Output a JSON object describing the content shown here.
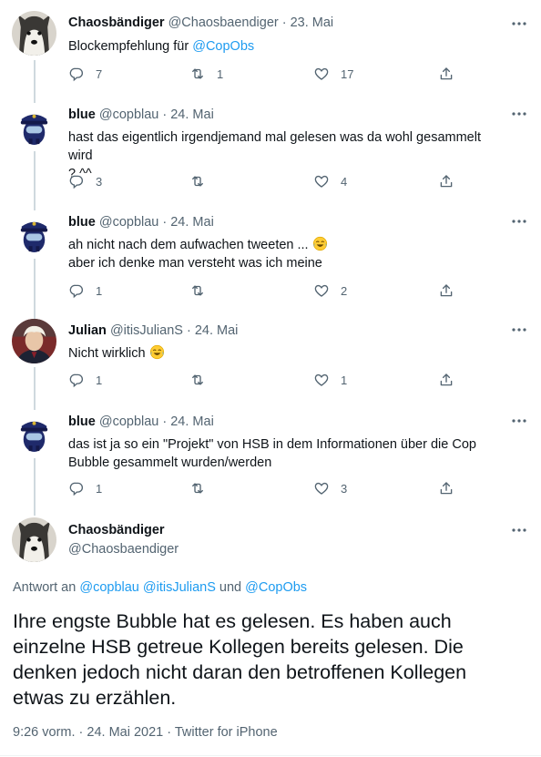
{
  "tweets": [
    {
      "name": "Chaosbändiger",
      "handle": "@Chaosbaendiger",
      "date": "· 23. Mai",
      "text_prefix": "Blockempfehlung für ",
      "text_link": "@CopObs",
      "replies": "7",
      "retweets": "1",
      "likes": "17"
    },
    {
      "name": "blue",
      "handle": "@copblau",
      "date": "· 24. Mai",
      "lines": [
        "hast das eigentlich irgendjemand mal gelesen was da wohl gesammelt wird",
        "? ^^"
      ],
      "replies": "3",
      "retweets": "",
      "likes": "4"
    },
    {
      "name": "blue",
      "handle": "@copblau",
      "date": "· 24. Mai",
      "lines": [
        "ah nicht nach dem aufwachen tweeten ... ",
        "aber ich denke man versteht was ich meine"
      ],
      "replies": "1",
      "retweets": "",
      "likes": "2"
    },
    {
      "name": "Julian",
      "handle": "@itisJulianS",
      "date": "· 24. Mai",
      "lines": [
        "Nicht wirklich "
      ],
      "replies": "1",
      "retweets": "",
      "likes": "1"
    },
    {
      "name": "blue",
      "handle": "@copblau",
      "date": "· 24. Mai",
      "lines": [
        "das ist ja so ein \"Projekt\" von HSB in dem Informationen über die Cop",
        "Bubble gesammelt wurden/werden"
      ],
      "replies": "1",
      "retweets": "",
      "likes": "3"
    }
  ],
  "main": {
    "name": "Chaosbändiger",
    "handle": "@Chaosbaendiger",
    "reply_prefix": "Antwort an ",
    "reply_user1": "@copblau",
    "reply_user2": "@itisJulianS",
    "reply_und": " und ",
    "reply_user3": "@CopObs",
    "text": "Ihre engste Bubble hat es gelesen. Es haben auch einzelne HSB getreue Kollegen bereits gelesen. Die denken jedoch nicht daran den betroffenen Kollegen etwas zu erzählen.",
    "timestamp": "9:26 vorm. · 24. Mai 2021 · Twitter for iPhone"
  },
  "icons": {
    "reply": "reply-icon",
    "retweet": "retweet-icon",
    "like": "like-icon",
    "share": "share-icon",
    "more": "more-icon",
    "emoji": "tears-of-joy-emoji"
  },
  "colors": {
    "link": "#1d9bf0",
    "muted": "#536471",
    "line": "#cfd9de"
  }
}
